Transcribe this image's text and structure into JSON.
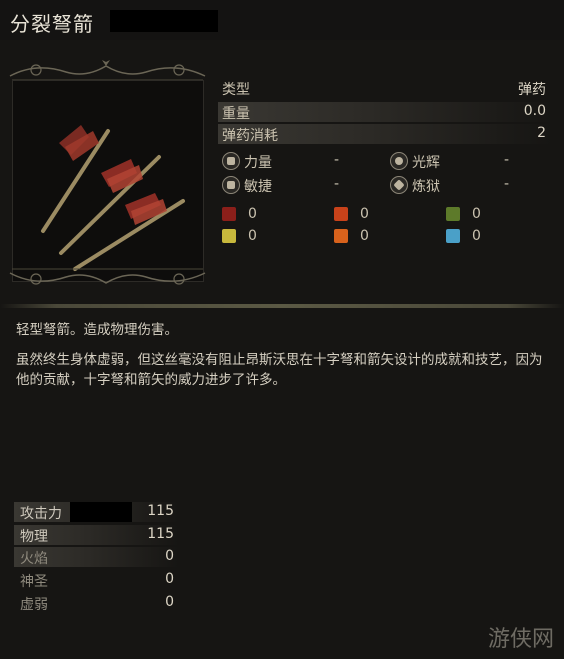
{
  "header": {
    "title": "分裂弩箭"
  },
  "properties": [
    {
      "label": "类型",
      "value": "弹药"
    },
    {
      "label": "重量",
      "value": "0.0"
    },
    {
      "label": "弹药消耗",
      "value": "2"
    }
  ],
  "requirements": [
    {
      "label": "力量",
      "value": "-"
    },
    {
      "label": "光辉",
      "value": "-"
    },
    {
      "label": "敏捷",
      "value": "-"
    },
    {
      "label": "炼狱",
      "value": "-"
    }
  ],
  "cuts": [
    "0",
    "0",
    "0",
    "0",
    "0",
    "0"
  ],
  "description": {
    "line1": "轻型弩箭。造成物理伤害。",
    "line2": "虽然终生身体虚弱，但这丝毫没有阻止昂斯沃思在十字弩和箭矢设计的成就和技艺，因为他的贡献，十字弩和箭矢的威力进步了许多。"
  },
  "attack": [
    {
      "label": "攻击力",
      "value": "115"
    },
    {
      "label": "物理",
      "value": "115"
    },
    {
      "label": "火焰",
      "value": "0"
    },
    {
      "label": "神圣",
      "value": "0"
    },
    {
      "label": "虚弱",
      "value": "0"
    }
  ],
  "watermark": "游侠网",
  "colors": {
    "background": "#161513",
    "text": "#cfc9bd",
    "accent": "#5b5944"
  }
}
